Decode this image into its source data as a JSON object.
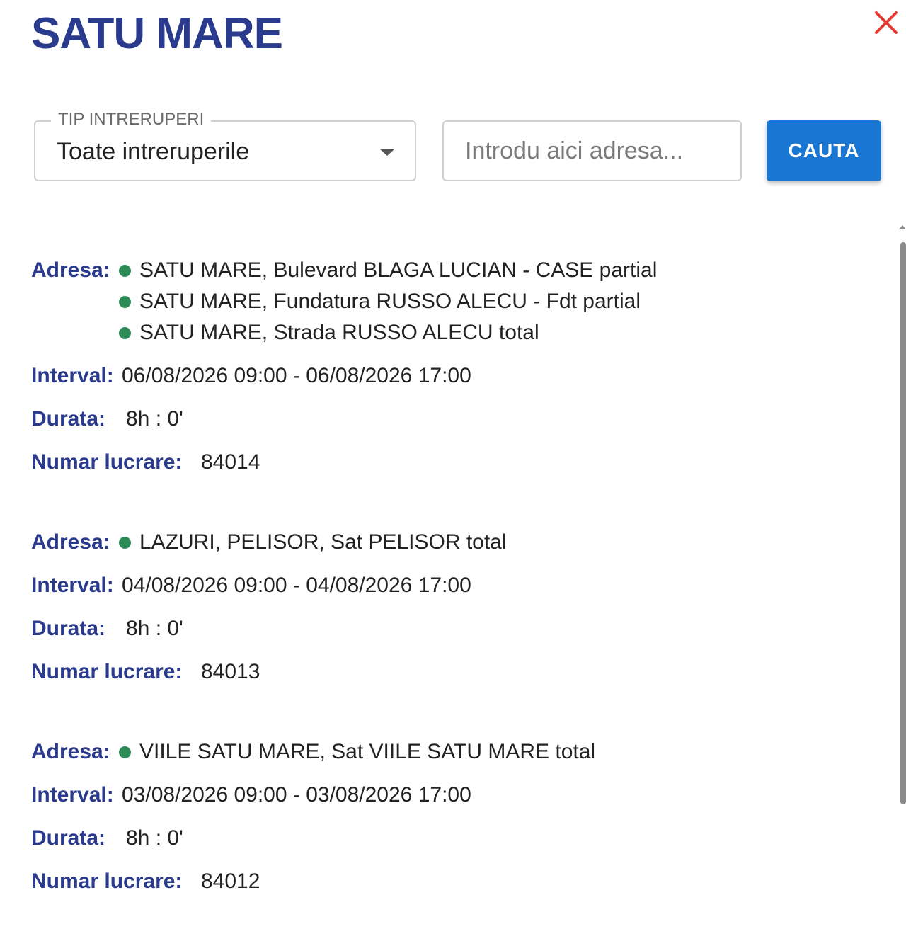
{
  "header": {
    "title": "SATU MARE",
    "close_icon": "close-x-icon",
    "close_color": "#e53935"
  },
  "filters": {
    "type_label": "TIP INTRERUPERI",
    "type_value": "Toate intreruperile",
    "address_placeholder": "Introdu aici adresa...",
    "address_value": "",
    "search_label": "CAUTA"
  },
  "labels": {
    "adresa": "Adresa:",
    "interval": "Interval:",
    "durata": "Durata:",
    "numar": "Numar lucrare:"
  },
  "colors": {
    "accent": "#1976d2",
    "label": "#2a3a8c",
    "status_dot": "#2e8b57"
  },
  "outages": [
    {
      "addresses": [
        "SATU MARE, Bulevard BLAGA LUCIAN - CASE partial",
        "SATU MARE, Fundatura RUSSO ALECU - Fdt partial",
        "SATU MARE, Strada RUSSO ALECU total"
      ],
      "interval": "06/08/2026 09:00 - 06/08/2026 17:00",
      "duration": "8h : 0'",
      "work_number": "84014"
    },
    {
      "addresses": [
        "LAZURI, PELISOR, Sat PELISOR total"
      ],
      "interval": "04/08/2026 09:00 - 04/08/2026 17:00",
      "duration": "8h : 0'",
      "work_number": "84013"
    },
    {
      "addresses": [
        "VIILE SATU MARE, Sat VIILE SATU MARE total"
      ],
      "interval": "03/08/2026 09:00 - 03/08/2026 17:00",
      "duration": "8h : 0'",
      "work_number": "84012"
    }
  ]
}
